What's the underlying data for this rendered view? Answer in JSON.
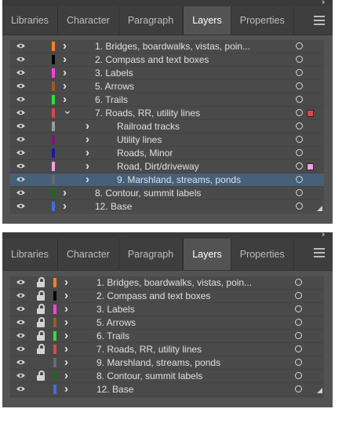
{
  "panel1": {
    "tabs": [
      {
        "label": "Libraries",
        "active": false
      },
      {
        "label": "Character",
        "active": false
      },
      {
        "label": "Paragraph",
        "active": false
      },
      {
        "label": "Layers",
        "active": true
      },
      {
        "label": "Properties",
        "active": false
      }
    ],
    "layers": [
      {
        "name": "1. Bridges, boardwalks, vistas, poin...",
        "color": "#ff7f1f",
        "indent": 0,
        "expanded": false,
        "selected": false,
        "square": null
      },
      {
        "name": "2. Compass and text boxes",
        "color": "#000000",
        "indent": 0,
        "expanded": false,
        "selected": false,
        "square": null
      },
      {
        "name": "3. Labels",
        "color": "#ff3fe0",
        "indent": 0,
        "expanded": false,
        "selected": false,
        "square": null
      },
      {
        "name": "5. Arrows",
        "color": "#9b5b1f",
        "indent": 0,
        "expanded": false,
        "selected": false,
        "square": null
      },
      {
        "name": "6. Trails",
        "color": "#27e33a",
        "indent": 0,
        "expanded": false,
        "selected": false,
        "square": null
      },
      {
        "name": "7. Roads, RR, utility lines",
        "color": "#e04646",
        "indent": 0,
        "expanded": true,
        "selected": false,
        "square": "#e04646"
      },
      {
        "name": "Railroad tracks",
        "color": "#9a9a9a",
        "indent": 1,
        "expanded": false,
        "selected": false,
        "square": null
      },
      {
        "name": "Utility lines",
        "color": "#7a1a7a",
        "indent": 1,
        "expanded": false,
        "selected": false,
        "square": null
      },
      {
        "name": "Roads, Minor",
        "color": "#1a1aa0",
        "indent": 1,
        "expanded": false,
        "selected": false,
        "square": null
      },
      {
        "name": "Road, Dirt/driveway",
        "color": "#ff9ee0",
        "indent": 1,
        "expanded": false,
        "selected": false,
        "square": "#ff9ee0"
      },
      {
        "name": "9. Marshland, streams, ponds",
        "color": "#6a6a6a",
        "indent": 1,
        "expanded": false,
        "selected": true,
        "square": null
      },
      {
        "name": "8. Contour, summit labels",
        "color": "#1a6b1a",
        "indent": 0,
        "expanded": false,
        "selected": false,
        "square": null
      },
      {
        "name": "12. Base",
        "color": "#3f6fe0",
        "indent": 0,
        "expanded": false,
        "selected": false,
        "square": null
      }
    ]
  },
  "panel2": {
    "tabs": [
      {
        "label": "Libraries",
        "active": false
      },
      {
        "label": "Character",
        "active": false
      },
      {
        "label": "Paragraph",
        "active": false
      },
      {
        "label": "Layers",
        "active": true
      },
      {
        "label": "Properties",
        "active": false
      }
    ],
    "layers": [
      {
        "name": "1. Bridges, boardwalks, vistas, poin...",
        "color": "#ff7f1f",
        "locked": true
      },
      {
        "name": "2. Compass and text boxes",
        "color": "#000000",
        "locked": true
      },
      {
        "name": "3. Labels",
        "color": "#ff3fe0",
        "locked": true
      },
      {
        "name": "5. Arrows",
        "color": "#9b5b1f",
        "locked": true
      },
      {
        "name": "6. Trails",
        "color": "#27e33a",
        "locked": true
      },
      {
        "name": "7. Roads, RR, utility lines",
        "color": "#e04646",
        "locked": true
      },
      {
        "name": "9. Marshland, streams, ponds",
        "color": "#6a6a6a",
        "locked": false
      },
      {
        "name": "8. Contour, summit labels",
        "color": "#1a6b1a",
        "locked": true
      },
      {
        "name": "12. Base",
        "color": "#3f6fe0",
        "locked": false
      }
    ]
  },
  "icons": {
    "eye": "eye-icon",
    "lock": "lock-icon",
    "chevron": "chevron-right-icon",
    "target": "target-circle-icon",
    "menu": "hamburger-menu-icon",
    "collapse": "double-chevron-icon"
  }
}
